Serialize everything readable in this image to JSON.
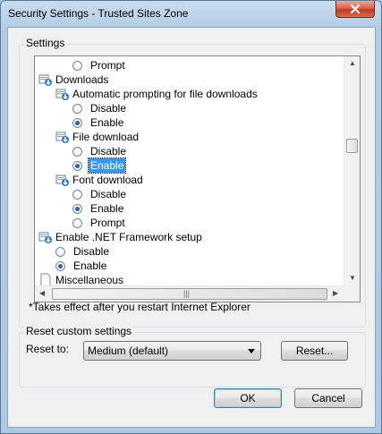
{
  "window": {
    "title": "Security Settings - Trusted Sites Zone"
  },
  "settings": {
    "group_label": "Settings",
    "items": [
      {
        "kind": "option",
        "label": "Prompt",
        "selected": false
      },
      {
        "kind": "category",
        "label": "Downloads"
      },
      {
        "kind": "subcategory",
        "label": "Automatic prompting for file downloads"
      },
      {
        "kind": "option",
        "label": "Disable",
        "selected": false
      },
      {
        "kind": "option",
        "label": "Enable",
        "selected": true
      },
      {
        "kind": "subcategory",
        "label": "File download"
      },
      {
        "kind": "option",
        "label": "Disable",
        "selected": false
      },
      {
        "kind": "option",
        "label": "Enable",
        "selected": true,
        "highlighted": true
      },
      {
        "kind": "subcategory",
        "label": "Font download"
      },
      {
        "kind": "option",
        "label": "Disable",
        "selected": false
      },
      {
        "kind": "option",
        "label": "Enable",
        "selected": true
      },
      {
        "kind": "option",
        "label": "Prompt",
        "selected": false
      },
      {
        "kind": "category",
        "label": "Enable .NET Framework setup"
      },
      {
        "kind": "option",
        "label": "Disable",
        "selected": false
      },
      {
        "kind": "option",
        "label": "Enable",
        "selected": true
      },
      {
        "kind": "category",
        "label": "Miscellaneous"
      }
    ],
    "note": "*Takes effect after you restart Internet Explorer"
  },
  "reset": {
    "group_label": "Reset custom settings",
    "reset_to_label": "Reset to:",
    "selected_level": "Medium (default)",
    "reset_button": "Reset..."
  },
  "footer": {
    "ok": "OK",
    "cancel": "Cancel"
  },
  "colors": {
    "selection": "#3399ff",
    "title_bar": "#c8dcef",
    "close_button": "#c2391d"
  }
}
